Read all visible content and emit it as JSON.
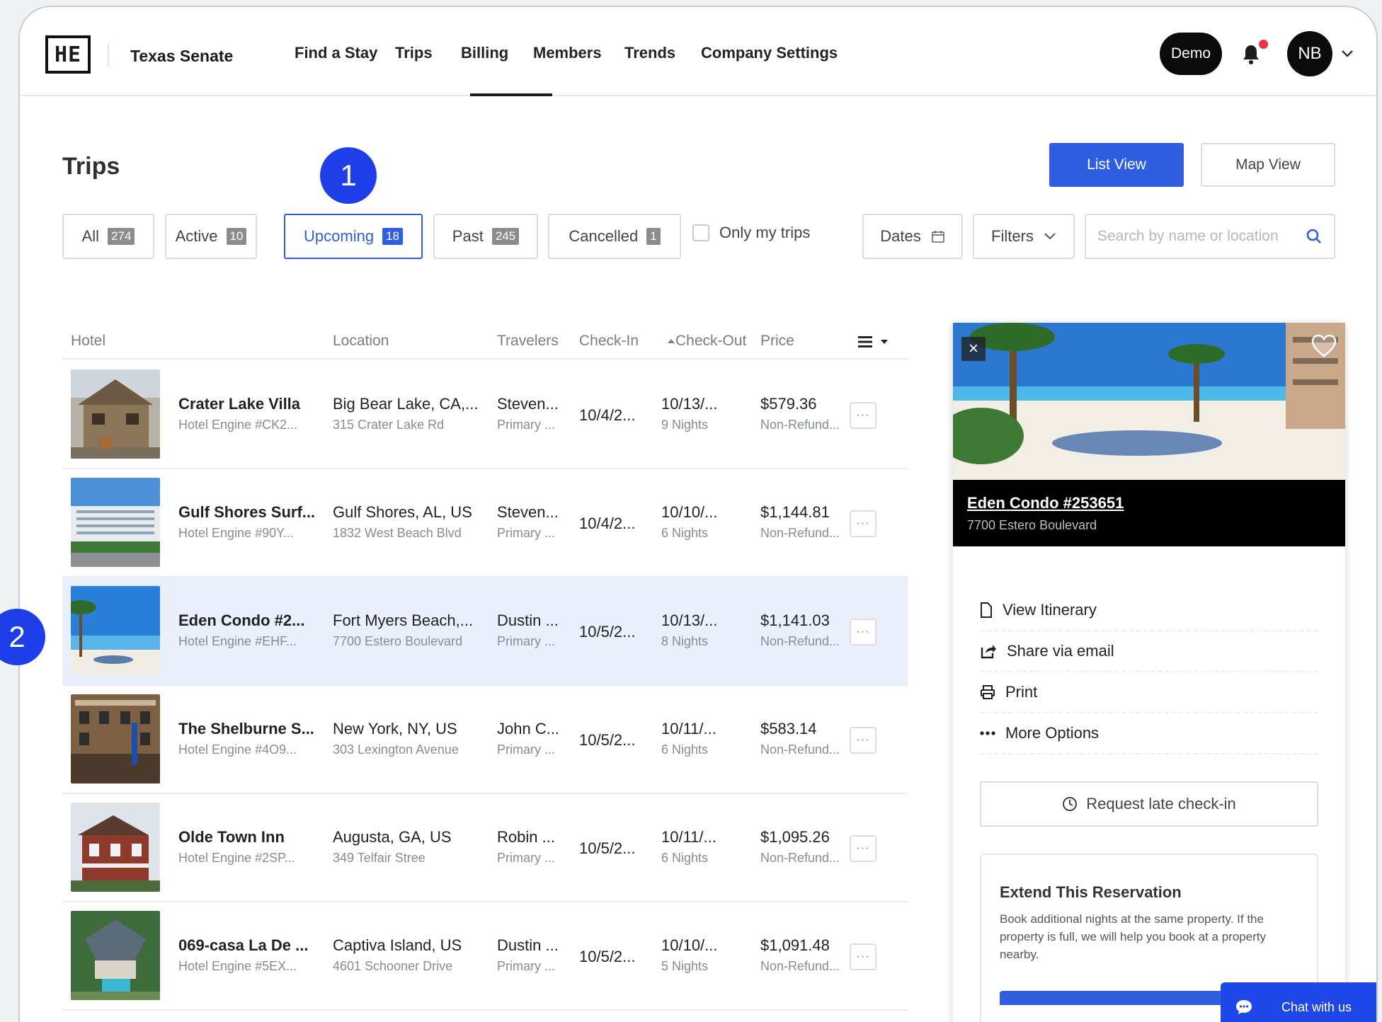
{
  "org": "Texas Senate",
  "logo_text": "HE",
  "nav": {
    "items": [
      "Find a Stay",
      "Trips",
      "Billing",
      "Members",
      "Trends",
      "Company Settings"
    ],
    "active": "Trips",
    "demo": "Demo",
    "avatar": "NB"
  },
  "page": {
    "title": "Trips",
    "list_view": "List View",
    "map_view": "Map View"
  },
  "callouts": [
    "1",
    "2"
  ],
  "tabs": [
    {
      "label": "All",
      "count": "274"
    },
    {
      "label": "Active",
      "count": "10"
    },
    {
      "label": "Upcoming",
      "count": "18"
    },
    {
      "label": "Past",
      "count": "245"
    },
    {
      "label": "Cancelled",
      "count": "1"
    }
  ],
  "active_tab": "Upcoming",
  "only_my_trips": "Only my trips",
  "dates": "Dates",
  "filters": "Filters",
  "search_placeholder": "Search by name or location",
  "columns": {
    "hotel": "Hotel",
    "location": "Location",
    "travelers": "Travelers",
    "checkin": "Check-In",
    "checkout": "Check-Out",
    "price": "Price"
  },
  "rows": [
    {
      "hotel": "Crater Lake Villa",
      "sub": "Hotel Engine #CK2...",
      "location": "Big Bear Lake, CA,...",
      "address": "315 Crater Lake Rd",
      "traveler": "Steven...",
      "role": "Primary ...",
      "checkin": "10/4/2...",
      "checkout": "10/13/...",
      "nights": "9 Nights",
      "price": "$579.36",
      "refund": "Non-Refund..."
    },
    {
      "hotel": "Gulf Shores Surf...",
      "sub": "Hotel Engine #90Y...",
      "location": "Gulf Shores, AL, US",
      "address": "1832 West Beach Blvd",
      "traveler": "Steven...",
      "role": "Primary ...",
      "checkin": "10/4/2...",
      "checkout": "10/10/...",
      "nights": "6 Nights",
      "price": "$1,144.81",
      "refund": "Non-Refund..."
    },
    {
      "hotel": "Eden Condo #2...",
      "sub": "Hotel Engine #EHF...",
      "location": "Fort Myers Beach,...",
      "address": "7700 Estero Boulevard",
      "traveler": "Dustin ...",
      "role": "Primary ...",
      "checkin": "10/5/2...",
      "checkout": "10/13/...",
      "nights": "8 Nights",
      "price": "$1,141.03",
      "refund": "Non-Refund..."
    },
    {
      "hotel": "The Shelburne S...",
      "sub": "Hotel Engine #4O9...",
      "location": "New York, NY, US",
      "address": "303 Lexington Avenue",
      "traveler": "John C...",
      "role": "Primary ...",
      "checkin": "10/5/2...",
      "checkout": "10/11/...",
      "nights": "6 Nights",
      "price": "$583.14",
      "refund": "Non-Refund..."
    },
    {
      "hotel": "Olde Town Inn",
      "sub": "Hotel Engine #2SP...",
      "location": "Augusta, GA, US",
      "address": "349 Telfair Stree",
      "traveler": "Robin ...",
      "role": "Primary ...",
      "checkin": "10/5/2...",
      "checkout": "10/11/...",
      "nights": "6 Nights",
      "price": "$1,095.26",
      "refund": "Non-Refund..."
    },
    {
      "hotel": "069-casa La De ...",
      "sub": "Hotel Engine #5EX...",
      "location": "Captiva Island, US",
      "address": "4601 Schooner Drive",
      "traveler": "Dustin ...",
      "role": "Primary ...",
      "checkin": "10/5/2...",
      "checkout": "10/10/...",
      "nights": "5 Nights",
      "price": "$1,091.48",
      "refund": "Non-Refund..."
    }
  ],
  "selected_row": 2,
  "more_glyph": "···",
  "panel": {
    "name": "Eden Condo #253651",
    "address": "7700 Estero Boulevard",
    "actions": [
      "View Itinerary",
      "Share via email",
      "Print",
      "More Options"
    ],
    "late_checkin": "Request late check-in",
    "extend_title": "Extend This Reservation",
    "extend_body": "Book additional nights at the same property. If the property is full, we will help you book at a property nearby."
  },
  "chat": "Chat with us",
  "colors": {
    "accent": "#2f5ee0",
    "callout": "#1d3ee8",
    "selected_row": "#e9effb",
    "notification": "#e8334a"
  }
}
